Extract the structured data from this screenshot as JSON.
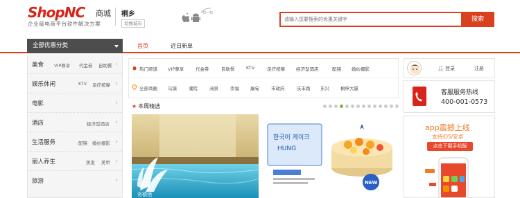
{
  "header": {
    "logo_brand": "ShopNC",
    "logo_suffix": "商城",
    "logo_slogan": "企业级电商平台软件解决方案",
    "city_name": "桐乡",
    "city_switch": "切换城市",
    "search_placeholder": "请输入您要搜索的优惠关键字",
    "search_button": "搜索"
  },
  "nav": {
    "category_header": "全部优惠分类",
    "tabs": [
      {
        "label": "首页",
        "active": true
      },
      {
        "label": "近日新单",
        "active": false
      }
    ]
  },
  "sidebar": {
    "items": [
      {
        "label": "美食",
        "tags": [
          "VIP尊享",
          "代金券",
          "自助餐"
        ]
      },
      {
        "label": "娱乐休闲",
        "tags": [
          "KTV",
          "足疗按摩"
        ]
      },
      {
        "label": "电影",
        "tags": []
      },
      {
        "label": "酒店",
        "tags": [
          "经济型酒店"
        ]
      },
      {
        "label": "生活服务",
        "tags": [
          "配镜",
          "婚纱摄影"
        ]
      },
      {
        "label": "丽人养生",
        "tags": [
          "美发",
          "美甲"
        ]
      },
      {
        "label": "旅游",
        "tags": []
      }
    ]
  },
  "filters": {
    "hot": [
      "热门频道",
      "VIP尊享",
      "代金券",
      "自助餐",
      "KTV",
      "足疗按摩",
      "经济型酒店",
      "配镜",
      "婚纱摄影"
    ],
    "areas": [
      "全部商圈",
      "乌镇",
      "濮院",
      "洲泉",
      "崇福",
      "屠甸",
      "市政府",
      "庆丰路",
      "东兴",
      "桐梓大厦"
    ]
  },
  "picks": {
    "title": "本周精选",
    "pool_caption": "浴德池",
    "cake_caption_1": "한국어 케이크",
    "cake_caption_2": "HUNG",
    "cake_badge": "NEW"
  },
  "user": {
    "login": "登录",
    "register": "注册"
  },
  "hotline": {
    "title": "客服服务热线",
    "number": "400-001-0573"
  },
  "app_promo": {
    "title": "app震撼上线",
    "subtitle": "支持iOS/安卓",
    "button": "点击下载手机版"
  },
  "colors": {
    "brand_red": "#d9241a",
    "accent_orange": "#d9401e",
    "nav_dark": "#4d4d4d"
  }
}
